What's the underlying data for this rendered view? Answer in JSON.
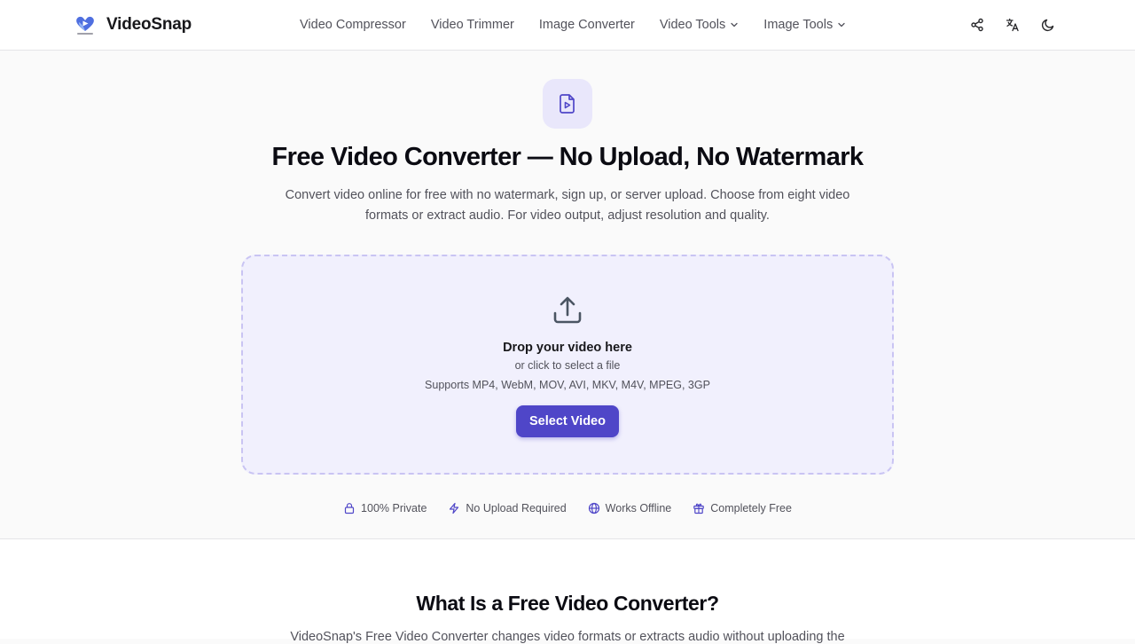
{
  "brand": {
    "name": "VideoSnap",
    "logo_text": "VideoSnap"
  },
  "nav": [
    {
      "label": "Video Compressor",
      "dropdown": false
    },
    {
      "label": "Video Trimmer",
      "dropdown": false
    },
    {
      "label": "Image Converter",
      "dropdown": false
    },
    {
      "label": "Video Tools",
      "dropdown": true
    },
    {
      "label": "Image Tools",
      "dropdown": true
    }
  ],
  "header_actions": [
    "share-icon",
    "translate-icon",
    "moon-icon"
  ],
  "hero": {
    "icon": "file-video-icon",
    "title": "Free Video Converter — No Upload, No Watermark",
    "subtitle": "Convert video online for free with no watermark, sign up, or server upload. Choose from eight video formats or extract audio. For video output, adjust resolution and quality."
  },
  "dropzone": {
    "icon": "upload-icon",
    "title": "Drop your video here",
    "or_text": "or click to select a file",
    "formats": "Supports MP4, WebM, MOV, AVI, MKV, M4V, MPEG, 3GP",
    "button_label": "Select Video"
  },
  "features": [
    {
      "label": "100% Private",
      "icon": "lock-icon"
    },
    {
      "label": "No Upload Required",
      "icon": "zap-icon"
    },
    {
      "label": "Works Offline",
      "icon": "globe-icon"
    },
    {
      "label": "Completely Free",
      "icon": "gift-icon"
    }
  ],
  "section2": {
    "title": "What Is a Free Video Converter?",
    "text": "VideoSnap's Free Video Converter changes video formats or extracts audio without uploading the"
  },
  "colors": {
    "accent": "#4f46c8",
    "accent_soft": "#e9e7fb",
    "dropzone_bg": "#f1f0fd",
    "dropzone_border": "#c9c4f3"
  }
}
